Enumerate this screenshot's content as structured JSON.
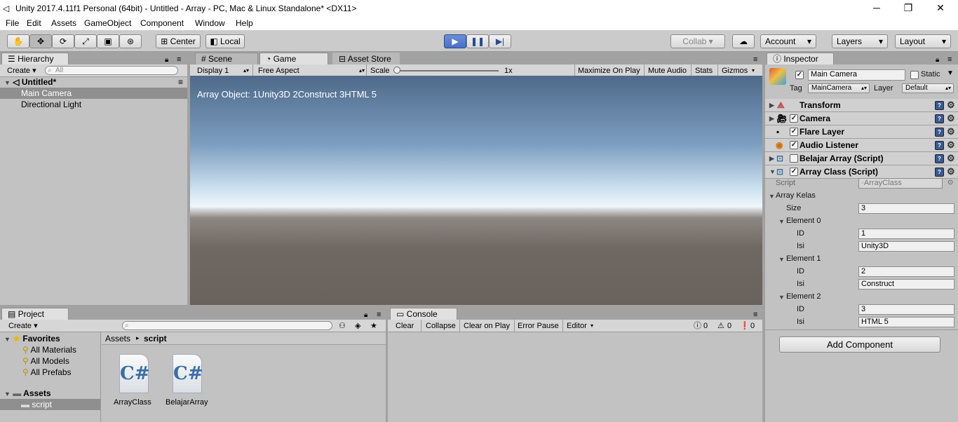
{
  "window": {
    "title": "Unity 2017.4.11f1 Personal (64bit) - Untitled - Array - PC, Mac & Linux Standalone* <DX11>",
    "minimize": "─",
    "maximize": "❐",
    "close": "✕"
  },
  "menu": [
    "File",
    "Edit",
    "Assets",
    "GameObject",
    "Component",
    "Window",
    "Help"
  ],
  "toolbar": {
    "center": "Center",
    "local": "Local",
    "collab": "Collab ▾",
    "account": "Account",
    "layers": "Layers",
    "layout": "Layout"
  },
  "hierarchy": {
    "tab": "Hierarchy",
    "create": "Create ▾",
    "search_placeholder": "All",
    "scene": "Untitled*",
    "items": [
      "Main Camera",
      "Directional Light"
    ]
  },
  "viewtabs": {
    "scene": "Scene",
    "game": "Game",
    "asset_store": "Asset Store"
  },
  "gamebar": {
    "display": "Display 1",
    "aspect": "Free Aspect",
    "scale": "Scale",
    "scale_value": "1x",
    "maximize": "Maximize On Play",
    "mute": "Mute Audio",
    "stats": "Stats",
    "gizmos": "Gizmos"
  },
  "game_text": "Array Object: 1Unity3D 2Construct 3HTML 5",
  "project": {
    "tab": "Project",
    "create": "Create ▾",
    "favorites": "Favorites",
    "fav_items": [
      "All Materials",
      "All Models",
      "All Prefabs"
    ],
    "assets": "Assets",
    "script_folder": "script",
    "breadcrumb_root": "Assets",
    "breadcrumb_leaf": "script",
    "files": [
      "ArrayClass",
      "BelajarArray"
    ],
    "file_glyph": "C#"
  },
  "console": {
    "tab": "Console",
    "clear": "Clear",
    "collapse": "Collapse",
    "clear_on_play": "Clear on Play",
    "error_pause": "Error Pause",
    "editor": "Editor",
    "log_count": "0",
    "warn_count": "0",
    "err_count": "0"
  },
  "inspector": {
    "tab": "Inspector",
    "name": "Main Camera",
    "static": "Static",
    "tag_label": "Tag",
    "tag": "MainCamera",
    "layer_label": "Layer",
    "layer": "Default",
    "components": [
      "Transform",
      "Camera",
      "Flare Layer",
      "Audio Listener",
      "Belajar Array (Script)",
      "Array Class (Script)"
    ],
    "script_label": "Script",
    "script_value": "ArrayClass",
    "array_label": "Array Kelas",
    "size_label": "Size",
    "size": "3",
    "elements": [
      {
        "label": "Element 0",
        "id_label": "ID",
        "id": "1",
        "isi_label": "Isi",
        "isi": "Unity3D"
      },
      {
        "label": "Element 1",
        "id_label": "ID",
        "id": "2",
        "isi_label": "Isi",
        "isi": "Construct"
      },
      {
        "label": "Element 2",
        "id_label": "ID",
        "id": "3",
        "isi_label": "Isi",
        "isi": "HTML 5"
      }
    ],
    "add_component": "Add Component"
  },
  "icons": [
    "unity-logo-icon",
    "hand-tool-icon",
    "move-tool-icon",
    "rotate-tool-icon",
    "scale-tool-icon",
    "rect-tool-icon",
    "transform-tool-icon",
    "play-icon",
    "pause-icon",
    "step-icon",
    "cloud-icon",
    "lock-icon",
    "menu-icon",
    "search-icon",
    "star-icon",
    "folder-icon",
    "gear-icon",
    "help-icon"
  ],
  "colors": {
    "play_active": "#4a70c8",
    "panel": "#c2c2c2",
    "selection": "#8f8f8f"
  }
}
